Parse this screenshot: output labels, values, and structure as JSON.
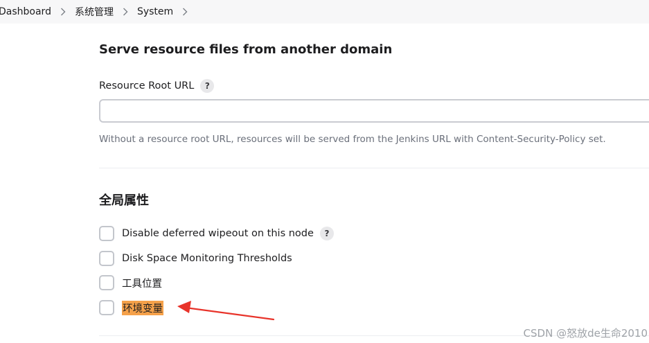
{
  "breadcrumb": {
    "items": [
      "Dashboard",
      "系统管理",
      "System"
    ]
  },
  "resource_section": {
    "title": "Serve resource files from another domain",
    "field_label": "Resource Root URL",
    "help_symbol": "?",
    "input_value": "",
    "help_text": "Without a resource root URL, resources will be served from the Jenkins URL with Content-Security-Policy set."
  },
  "global_section": {
    "title": "全局属性",
    "options": [
      {
        "label": "Disable deferred wipeout on this node",
        "checked": false,
        "has_help": true,
        "help_symbol": "?"
      },
      {
        "label": "Disk Space Monitoring Thresholds",
        "checked": false,
        "has_help": false
      },
      {
        "label": "工具位置",
        "checked": false,
        "has_help": false
      },
      {
        "label": "环境变量",
        "checked": false,
        "has_help": false,
        "highlighted": true
      }
    ]
  },
  "annotation": {
    "arrow_color": "#e8332a",
    "highlight_color": "#f5a14a"
  },
  "watermark": "CSDN @怒放de生命2010"
}
